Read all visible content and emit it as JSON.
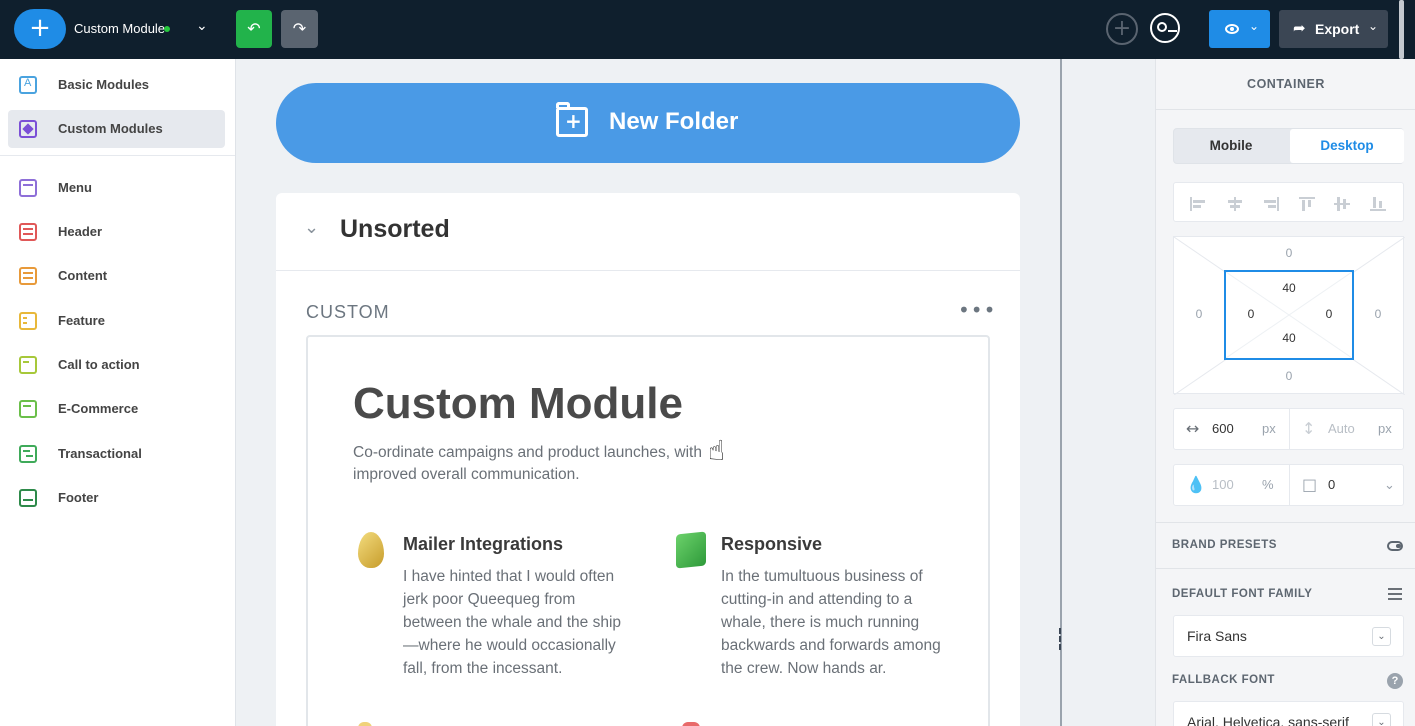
{
  "topbar": {
    "add_icon": "plus-icon",
    "module_title": "Custom Module",
    "status_color": "#27c93f",
    "undo_icon": "undo-icon",
    "redo_icon": "redo-icon",
    "preview_icon": "eye-icon",
    "export_label": "Export",
    "accent": "#1f8ce6",
    "undo_color": "#22b34b"
  },
  "sidebar": {
    "items": [
      {
        "label": "Basic Modules",
        "icon": "letter-a-icon",
        "color": "#4aa3df"
      },
      {
        "label": "Custom Modules",
        "icon": "custom-modules-icon",
        "color": "#7b4fd6",
        "active": true
      },
      {
        "label": "Menu",
        "icon": "menu-module-icon",
        "color": "#8e6fd8"
      },
      {
        "label": "Header",
        "icon": "header-module-icon",
        "color": "#e05858"
      },
      {
        "label": "Content",
        "icon": "content-module-icon",
        "color": "#e89a3a"
      },
      {
        "label": "Feature",
        "icon": "feature-module-icon",
        "color": "#e8b83a"
      },
      {
        "label": "Call to action",
        "icon": "cta-module-icon",
        "color": "#a7c83a"
      },
      {
        "label": "E-Commerce",
        "icon": "cart-icon",
        "color": "#6bbf4a"
      },
      {
        "label": "Transactional",
        "icon": "transactional-module-icon",
        "color": "#3faa5a"
      },
      {
        "label": "Footer",
        "icon": "footer-module-icon",
        "color": "#2e8a4a"
      }
    ]
  },
  "canvas": {
    "new_folder_label": "New Folder",
    "folder_name": "Unsorted",
    "section_label": "CUSTOM",
    "card": {
      "title": "Custom Module",
      "subtitle": "Co-ordinate campaigns and product launches, with improved overall communication.",
      "features": [
        {
          "title": "Mailer Integrations",
          "text": "I have hinted that I would often jerk poor Queequeg from between the whale and the ship—where he would occasionally fall, from the incessant.",
          "icon": "egg-icon"
        },
        {
          "title": "Responsive",
          "text": "In the tumultuous business of cutting-in and attending to a whale, there is much running backwards and forwards among the crew. Now hands ar.",
          "icon": "green-shape-icon"
        }
      ]
    }
  },
  "panel": {
    "title": "CONTAINER",
    "tabs": [
      "Mobile",
      "Desktop"
    ],
    "selected_tab": "Desktop",
    "margin": {
      "top": "0",
      "right": "0",
      "bottom": "0",
      "left": "0"
    },
    "padding": {
      "top": "40",
      "right": "0",
      "bottom": "40",
      "left": "0"
    },
    "width_value": "600",
    "width_unit": "px",
    "height_value": "Auto",
    "height_unit": "px",
    "opacity_value": "100",
    "opacity_unit": "%",
    "radius_value": "0",
    "brand_presets_label": "BRAND PRESETS",
    "default_font_label": "DEFAULT FONT FAMILY",
    "default_font_value": "Fira Sans",
    "fallback_font_label": "FALLBACK FONT",
    "fallback_font_value": "Arial, Helvetica, sans-serif"
  }
}
